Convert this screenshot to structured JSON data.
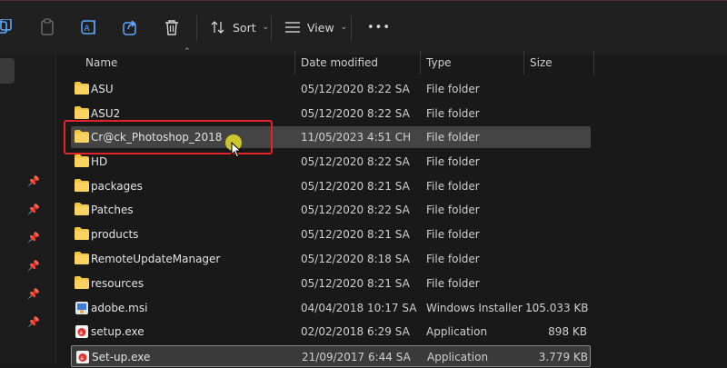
{
  "toolbar": {
    "copy_icon": "copy-icon",
    "paste_icon": "paste-icon",
    "rename_icon": "rename-icon",
    "share_icon": "share-icon",
    "delete_icon": "delete-icon",
    "sort_label": "Sort",
    "view_label": "View",
    "more_label": "•••"
  },
  "columns": {
    "name": "Name",
    "date": "Date modified",
    "type": "Type",
    "size": "Size"
  },
  "files": [
    {
      "name": "ASU",
      "date": "05/12/2020 8:22 SA",
      "type": "File folder",
      "size": "",
      "icon": "folder-icon"
    },
    {
      "name": "ASU2",
      "date": "05/12/2020 8:22 SA",
      "type": "File folder",
      "size": "",
      "icon": "folder-icon"
    },
    {
      "name": "Cr@ck_Photoshop_2018",
      "date": "11/05/2023 4:51 CH",
      "type": "File folder",
      "size": "",
      "icon": "folder-icon"
    },
    {
      "name": "HD",
      "date": "05/12/2020 8:22 SA",
      "type": "File folder",
      "size": "",
      "icon": "folder-icon"
    },
    {
      "name": "packages",
      "date": "05/12/2020 8:21 SA",
      "type": "File folder",
      "size": "",
      "icon": "folder-icon"
    },
    {
      "name": "Patches",
      "date": "05/12/2020 8:22 SA",
      "type": "File folder",
      "size": "",
      "icon": "folder-icon"
    },
    {
      "name": "products",
      "date": "05/12/2020 8:21 SA",
      "type": "File folder",
      "size": "",
      "icon": "folder-icon"
    },
    {
      "name": "RemoteUpdateManager",
      "date": "05/12/2020 8:18 SA",
      "type": "File folder",
      "size": "",
      "icon": "folder-icon"
    },
    {
      "name": "resources",
      "date": "05/12/2020 8:21 SA",
      "type": "File folder",
      "size": "",
      "icon": "folder-icon"
    },
    {
      "name": "adobe.msi",
      "date": "04/04/2018 10:17 SA",
      "type": "Windows Installer ...",
      "size": "105.033 KB",
      "icon": "msi-installer-icon"
    },
    {
      "name": "setup.exe",
      "date": "02/02/2018 6:29 SA",
      "type": "Application",
      "size": "898 KB",
      "icon": "adobe-app-icon"
    },
    {
      "name": "Set-up.exe",
      "date": "21/09/2017 6:44 SA",
      "type": "Application",
      "size": "3.779 KB",
      "icon": "adobe-app-icon"
    }
  ],
  "colors": {
    "highlight_box": "#e2232a",
    "folder": "#f4c542",
    "cursor_halo": "#e6dc28"
  }
}
